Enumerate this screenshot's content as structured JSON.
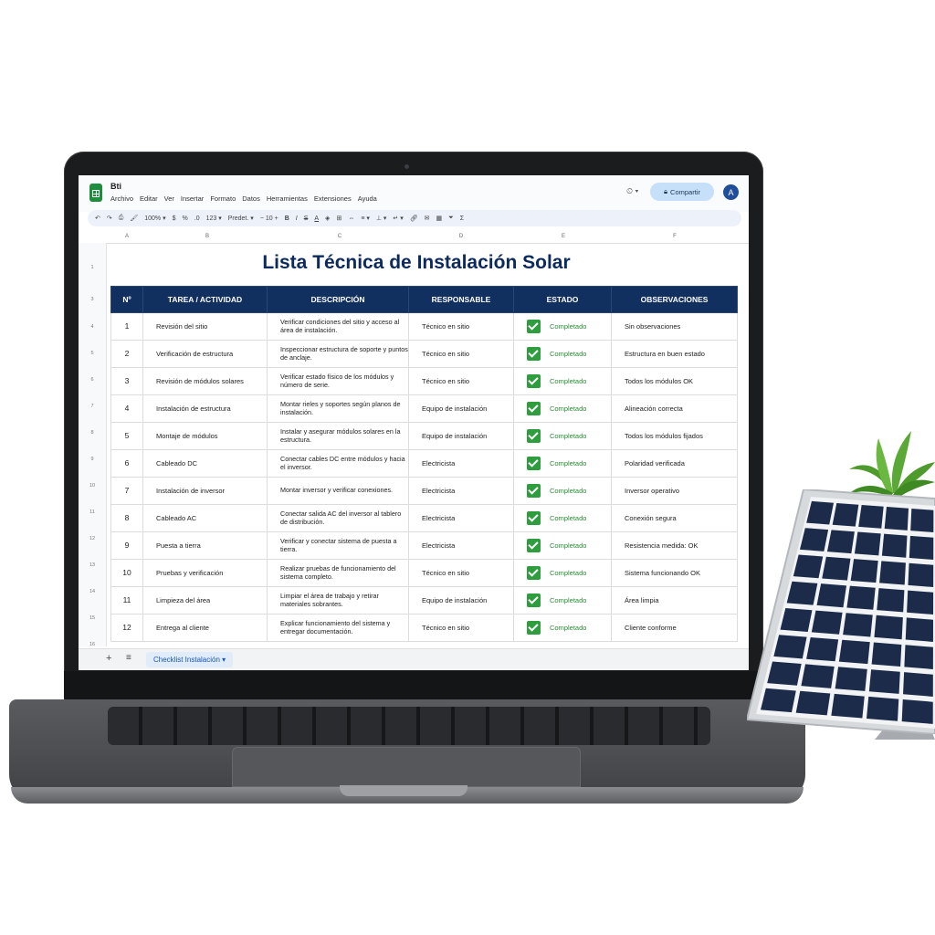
{
  "app": {
    "doc_title": "Bti",
    "menus": [
      "Archivo",
      "Editar",
      "Ver",
      "Insertar",
      "Formato",
      "Datos",
      "Herramientas",
      "Extensiones",
      "Ayuda"
    ],
    "share_label": "Compartir",
    "avatar_letter": "A",
    "zoom": "100%",
    "font_name": "Predet.",
    "font_size": "10"
  },
  "columns": [
    "A",
    "B",
    "C",
    "D",
    "E",
    "F",
    "G"
  ],
  "rows": [
    "1",
    "2",
    "3",
    "4",
    "5",
    "6",
    "7",
    "8",
    "9",
    "10",
    "11",
    "12",
    "13",
    "14",
    "15",
    "16"
  ],
  "sheet": {
    "title": "Lista Técnica de Instalación Solar",
    "headers": [
      "Nº",
      "TAREA / ACTIVIDAD",
      "DESCRIPCIÓN",
      "RESPONSABLE",
      "ESTADO",
      "OBSERVACIONES"
    ],
    "tasks": [
      {
        "n": "1",
        "task": "Revisión del sitio",
        "desc": "Verificar condiciones del sitio y acceso al área de instalación.",
        "resp": "Técnico en sitio",
        "status": "Completado",
        "obs": "Sin observaciones"
      },
      {
        "n": "2",
        "task": "Verificación de estructura",
        "desc": "Inspeccionar estructura de soporte y puntos de anclaje.",
        "resp": "Técnico en sitio",
        "status": "Completado",
        "obs": "Estructura en buen estado"
      },
      {
        "n": "3",
        "task": "Revisión de módulos solares",
        "desc": "Verificar estado físico de los módulos y número de serie.",
        "resp": "Técnico en sitio",
        "status": "Completado",
        "obs": "Todos los módulos OK"
      },
      {
        "n": "4",
        "task": "Instalación de estructura",
        "desc": "Montar rieles y soportes según planos de instalación.",
        "resp": "Equipo de instalación",
        "status": "Completado",
        "obs": "Alineación correcta"
      },
      {
        "n": "5",
        "task": "Montaje de módulos",
        "desc": "Instalar y asegurar módulos solares en la estructura.",
        "resp": "Equipo de instalación",
        "status": "Completado",
        "obs": "Todos los módulos fijados"
      },
      {
        "n": "6",
        "task": "Cableado DC",
        "desc": "Conectar cables DC entre módulos y hacia el inversor.",
        "resp": "Electricista",
        "status": "Completado",
        "obs": "Polaridad verificada"
      },
      {
        "n": "7",
        "task": "Instalación de inversor",
        "desc": "Montar inversor y verificar conexiones.",
        "resp": "Electricista",
        "status": "Completado",
        "obs": "Inversor operativo"
      },
      {
        "n": "8",
        "task": "Cableado AC",
        "desc": "Conectar salida AC del inversor al tablero de distribución.",
        "resp": "Electricista",
        "status": "Completado",
        "obs": "Conexión segura"
      },
      {
        "n": "9",
        "task": "Puesta a tierra",
        "desc": "Verificar y conectar sistema de puesta a tierra.",
        "resp": "Electricista",
        "status": "Completado",
        "obs": "Resistencia medida: OK"
      },
      {
        "n": "10",
        "task": "Pruebas y verificación",
        "desc": "Realizar pruebas de funcionamiento del sistema completo.",
        "resp": "Técnico en sitio",
        "status": "Completado",
        "obs": "Sistema funcionando OK"
      },
      {
        "n": "11",
        "task": "Limpieza del área",
        "desc": "Limpiar el área de trabajo y retirar materiales sobrantes.",
        "resp": "Equipo de instalación",
        "status": "Completado",
        "obs": "Área limpia"
      },
      {
        "n": "12",
        "task": "Entrega al cliente",
        "desc": "Explicar funcionamiento del sistema y entregar documentación.",
        "resp": "Técnico en sitio",
        "status": "Completado",
        "obs": "Cliente conforme"
      }
    ]
  },
  "tabs": {
    "active": "Checklist Instalación"
  },
  "colors": {
    "header_bg": "#12305f",
    "title": "#0d2a5e",
    "check": "#2e9d3d",
    "status_text": "#2a8c36"
  }
}
